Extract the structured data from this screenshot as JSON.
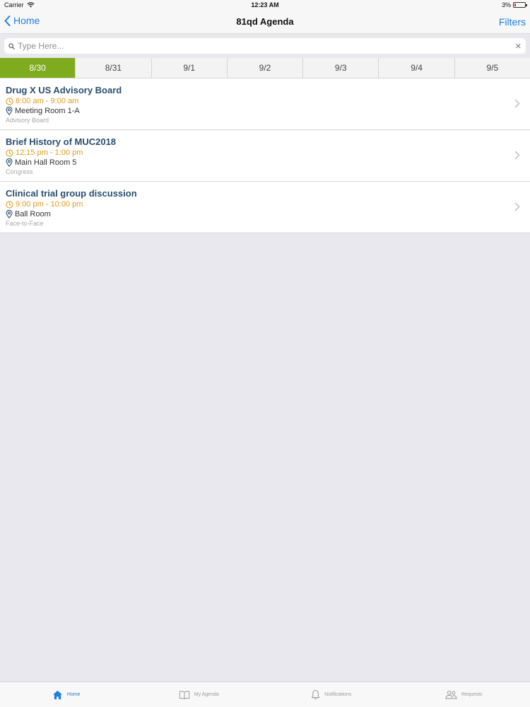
{
  "status_bar": {
    "carrier": "Carrier",
    "time": "12:23 AM",
    "battery": "3%"
  },
  "nav": {
    "back_label": "Home",
    "title": "81qd Agenda",
    "filters_label": "Filters"
  },
  "search": {
    "placeholder": "Type Here..."
  },
  "date_tabs": [
    {
      "label": "8/30",
      "active": true
    },
    {
      "label": "8/31"
    },
    {
      "label": "9/1"
    },
    {
      "label": "9/2"
    },
    {
      "label": "9/3"
    },
    {
      "label": "9/4"
    },
    {
      "label": "9/5"
    }
  ],
  "agenda": [
    {
      "title": "Drug X US Advisory Board",
      "time": "8:00 am - 9:00 am",
      "location": "Meeting Room 1-A",
      "type": "Advisory Board"
    },
    {
      "title": "Brief History of MUC2018",
      "time": "12:15 pm - 1:00 pm",
      "location": "Main Hall Room 5",
      "type": "Congress"
    },
    {
      "title": "Clinical trial group discussion",
      "time": "9:00 pm - 10:00 pm",
      "location": "Ball Room",
      "type": "Face-to-Face"
    }
  ],
  "tab_bar": [
    {
      "label": "Home",
      "icon": "home-icon",
      "active": true
    },
    {
      "label": "My Agenda",
      "icon": "book-icon"
    },
    {
      "label": "Notifications",
      "icon": "bell-icon"
    },
    {
      "label": "Requests",
      "icon": "people-icon"
    }
  ],
  "colors": {
    "accent": "#1f7fe0",
    "active_date": "#7fab1e",
    "time": "#e29b1b",
    "title": "#2a4e70"
  }
}
